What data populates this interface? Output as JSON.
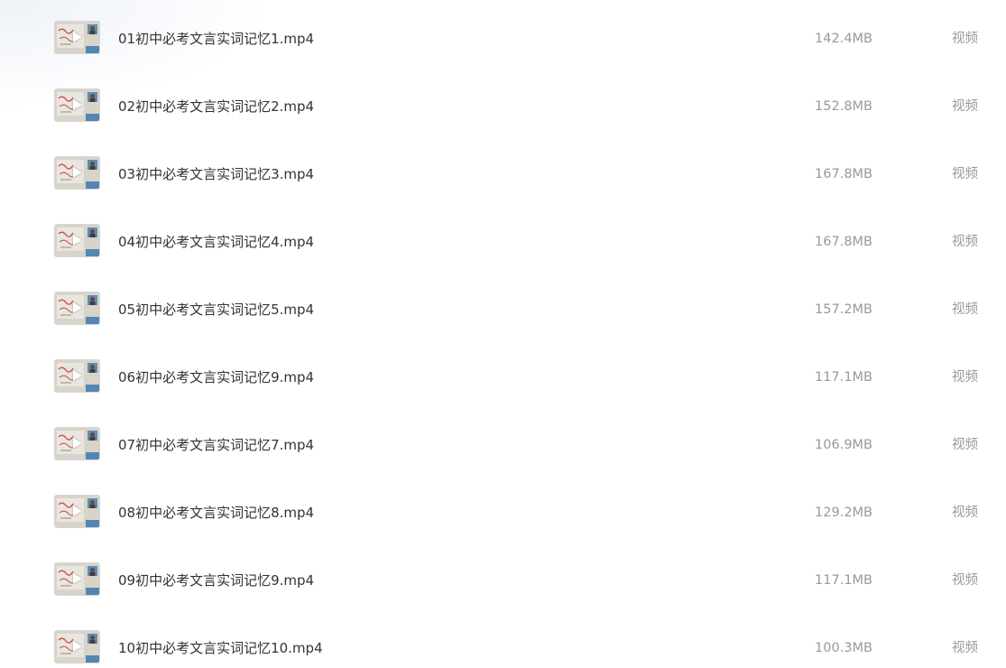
{
  "files": [
    {
      "name": "01初中必考文言实词记忆1.mp4",
      "size": "142.4MB",
      "type": "视频",
      "thumbnail_icon": "video-thumbnail-icon"
    },
    {
      "name": "02初中必考文言实词记忆2.mp4",
      "size": "152.8MB",
      "type": "视频",
      "thumbnail_icon": "video-thumbnail-icon"
    },
    {
      "name": "03初中必考文言实词记忆3.mp4",
      "size": "167.8MB",
      "type": "视频",
      "thumbnail_icon": "video-thumbnail-icon"
    },
    {
      "name": "04初中必考文言实词记忆4.mp4",
      "size": "167.8MB",
      "type": "视频",
      "thumbnail_icon": "video-thumbnail-icon"
    },
    {
      "name": "05初中必考文言实词记忆5.mp4",
      "size": "157.2MB",
      "type": "视频",
      "thumbnail_icon": "video-thumbnail-icon"
    },
    {
      "name": "06初中必考文言实词记忆9.mp4",
      "size": "117.1MB",
      "type": "视频",
      "thumbnail_icon": "video-thumbnail-icon"
    },
    {
      "name": "07初中必考文言实词记忆7.mp4",
      "size": "106.9MB",
      "type": "视频",
      "thumbnail_icon": "video-thumbnail-icon"
    },
    {
      "name": "08初中必考文言实词记忆8.mp4",
      "size": "129.2MB",
      "type": "视频",
      "thumbnail_icon": "video-thumbnail-icon"
    },
    {
      "name": "09初中必考文言实词记忆9.mp4",
      "size": "117.1MB",
      "type": "视频",
      "thumbnail_icon": "video-thumbnail-icon"
    },
    {
      "name": "10初中必考文言实词记忆10.mp4",
      "size": "100.3MB",
      "type": "视频",
      "thumbnail_icon": "video-thumbnail-icon"
    }
  ],
  "colors": {
    "name_text": "#333333",
    "meta_text": "#999999",
    "thumb_bg": "#d8d4ca",
    "thumb_accent_red": "#c9564c",
    "thumb_accent_blue": "#3d78b0",
    "play_icon": "#ffffff"
  }
}
